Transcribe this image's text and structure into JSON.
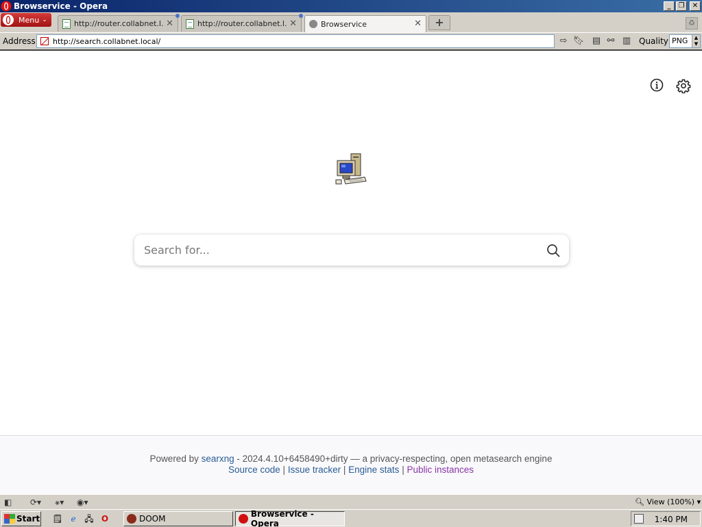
{
  "window": {
    "title": "Browservice - Opera",
    "minimize": "_",
    "restore": "❐",
    "close": "✕"
  },
  "menu": {
    "label": "Menu",
    "chevron": "⌄"
  },
  "tabs": [
    {
      "label": "http://router.collabnet.l...",
      "icon": "page-icon",
      "close": "✕"
    },
    {
      "label": "http://router.collabnet.l...",
      "icon": "page-icon",
      "close": "✕"
    },
    {
      "label": "Browservice",
      "icon": "loading-dots-icon",
      "close": "✕"
    }
  ],
  "newtab": {
    "label": "+"
  },
  "address": {
    "label": "Address",
    "url": "http://search.collabnet.local/"
  },
  "quality": {
    "label": "Quality",
    "value": "PNG"
  },
  "search": {
    "placeholder": "Search for..."
  },
  "footer": {
    "powered_by": "Powered by",
    "engine_name": "searxng",
    "version_text": "- 2024.4.10+6458490+dirty — a privacy-respecting, open metasearch engine",
    "links": [
      "Source code",
      "Issue tracker",
      "Engine stats",
      "Public instances"
    ],
    "sep": "|"
  },
  "statusbar": {
    "zoom": "View (100%)"
  },
  "taskbar": {
    "start": "Start",
    "tasks": [
      {
        "label": "DOOM"
      },
      {
        "label": "Browservice - Opera"
      }
    ],
    "clock": "1:40 PM"
  }
}
